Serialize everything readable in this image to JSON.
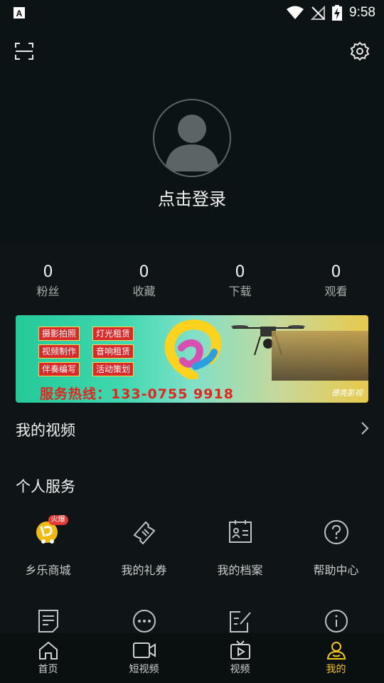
{
  "status_bar": {
    "time": "9:58"
  },
  "profile": {
    "login_prompt": "点击登录"
  },
  "stats": [
    {
      "value": "0",
      "label": "粉丝"
    },
    {
      "value": "0",
      "label": "收藏"
    },
    {
      "value": "0",
      "label": "下载"
    },
    {
      "value": "0",
      "label": "观看"
    }
  ],
  "banner": {
    "tags": [
      "摄影拍照",
      "灯光租赁",
      "视频制作",
      "音响租赁",
      "伴奏编写",
      "活动策划"
    ],
    "hotline": "服务热线：133-0755 9918",
    "signature": "德亮影视"
  },
  "my_videos": {
    "title": "我的视频"
  },
  "personal_services": {
    "title": "个人服务",
    "items": [
      {
        "label": "乡乐商城",
        "icon": "shop-icon",
        "badge": "火爆"
      },
      {
        "label": "我的礼券",
        "icon": "coupon-icon"
      },
      {
        "label": "我的档案",
        "icon": "profile-card-icon"
      },
      {
        "label": "帮助中心",
        "icon": "help-icon"
      }
    ],
    "items_row2": [
      {
        "icon": "note-icon"
      },
      {
        "icon": "more-icon"
      },
      {
        "icon": "edit-icon"
      },
      {
        "icon": "info-icon"
      }
    ]
  },
  "tabbar": {
    "items": [
      {
        "label": "首页",
        "icon": "home-icon"
      },
      {
        "label": "短视频",
        "icon": "camera-icon"
      },
      {
        "label": "视频",
        "icon": "tv-icon"
      },
      {
        "label": "我的",
        "icon": "user-icon",
        "active": true
      }
    ],
    "active_color": "#f5c518"
  }
}
